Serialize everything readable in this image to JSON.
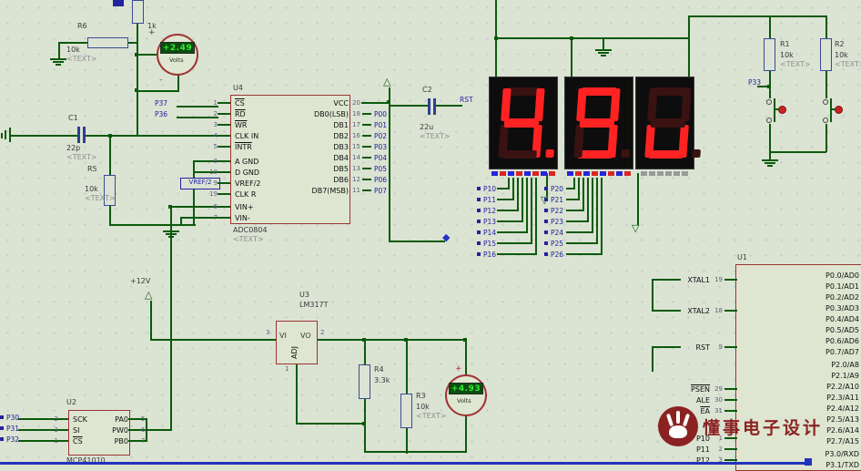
{
  "colors": {
    "wire": "#0b5a0b",
    "net_label": "#23239c",
    "component_outline": "#9a3434",
    "resistor_outline": "#3b4a97",
    "seg_on": "#ff2222",
    "seg_off": "#3a1212",
    "meter_panel_bg": "#0d4d10",
    "meter_panel_text": "#33ee33",
    "watermark": "#8b2222"
  },
  "watermark": {
    "text": "懂事电子设计"
  },
  "power": {
    "rail_label": "+12V"
  },
  "symbols": {
    "plus": "+",
    "minus": "-"
  },
  "icons": {
    "up_arrow": "△",
    "down_arrow": "▽",
    "diamond": "◆"
  },
  "display": {
    "value_shown": "4.9u",
    "digits": [
      {
        "char": "4",
        "dp": true
      },
      {
        "char": "9",
        "dp": false
      },
      {
        "char": "u",
        "dp": false
      }
    ],
    "indicators": {
      "d1": [
        "#2626d8",
        "#d82626",
        "#2626d8",
        "#d82626",
        "#2626d8",
        "#d82626",
        "#2626d8",
        "#d82626"
      ],
      "d2": [
        "#2626d8",
        "#d82626",
        "#2626d8",
        "#d82626",
        "#2626d8",
        "#d82626",
        "#2626d8",
        "#d82626"
      ],
      "d3": [
        "#9a9a9a",
        "#9a9a9a",
        "#9a9a9a",
        "#9a9a9a",
        "#9a9a9a",
        "#9a9a9a"
      ]
    }
  },
  "meters": {
    "vm1": {
      "value": "+2.49",
      "unit": "Volts"
    },
    "vm2": {
      "value": "+4.93",
      "unit": "Volts"
    }
  },
  "parts": {
    "r_top": {
      "value": "1k"
    },
    "r6": {
      "ref": "R6",
      "value": "10k",
      "text": "<TEXT>"
    },
    "r5": {
      "ref": "R5",
      "value": "10k",
      "text": "<TEXT>"
    },
    "r4": {
      "ref": "R4",
      "value": "3.3k"
    },
    "r3": {
      "ref": "R3",
      "value": "10k",
      "text": "<TEXT>"
    },
    "r1": {
      "ref": "R1",
      "value": "10k",
      "text": "<TEXT>"
    },
    "r2": {
      "ref": "R2",
      "value": "10k",
      "text": "<TEXT>"
    },
    "c1": {
      "ref": "C1",
      "value": "22p",
      "text": "<TEXT>"
    },
    "c2": {
      "ref": "C2",
      "value": "22u",
      "text": "<TEXT>"
    },
    "u1": {
      "ref": "U1"
    },
    "u2": {
      "ref": "U2",
      "device": "MCP41010"
    },
    "u3": {
      "ref": "U3",
      "device": "LM317T"
    },
    "u4": {
      "ref": "U4",
      "device": "ADC0804",
      "text": "<TEXT>"
    }
  },
  "nets": {
    "p37": "P37",
    "p36": "P36",
    "vref": "VREF/2",
    "rst": "RST",
    "p33": "P33"
  },
  "u3_pins": {
    "vi": "VI",
    "vo": "VO",
    "adj": "ADJ",
    "vi_num": "3",
    "vo_num": "2",
    "adj_num": "1"
  },
  "u4_left_pins": [
    {
      "num": "1",
      "name": "CS",
      "bar": true
    },
    {
      "num": "2",
      "name": "RD",
      "bar": true
    },
    {
      "num": "3",
      "name": "WR",
      "bar": true
    },
    {
      "num": "4",
      "name": "CLK IN"
    },
    {
      "num": "5",
      "name": "INTR",
      "bar": true
    },
    {
      "num": "8",
      "name": "A GND"
    },
    {
      "num": "10",
      "name": "D GND"
    },
    {
      "num": "9",
      "name": "VREF/2"
    },
    {
      "num": "19",
      "name": "CLK R"
    },
    {
      "num": "6",
      "name": "VIN+"
    },
    {
      "num": "7",
      "name": "VIN-"
    }
  ],
  "u4_right_pins": [
    {
      "num": "20",
      "name": "VCC",
      "net": ""
    },
    {
      "num": "18",
      "name": "DB0(LSB)",
      "net": "P00"
    },
    {
      "num": "17",
      "name": "DB1",
      "net": "P01"
    },
    {
      "num": "16",
      "name": "DB2",
      "net": "P02"
    },
    {
      "num": "15",
      "name": "DB3",
      "net": "P03"
    },
    {
      "num": "14",
      "name": "DB4",
      "net": "P04"
    },
    {
      "num": "13",
      "name": "DB5",
      "net": "P05"
    },
    {
      "num": "12",
      "name": "DB6",
      "net": "P06"
    },
    {
      "num": "11",
      "name": "DB7(MSB)",
      "net": "P07"
    }
  ],
  "u1_left_pins": [
    {
      "num": "19",
      "name": "XTAL1"
    },
    {
      "num": "18",
      "name": "XTAL2"
    },
    {
      "num": "9",
      "name": "RST"
    },
    {
      "num": "29",
      "name": "PSEN",
      "bar": true
    },
    {
      "num": "30",
      "name": "ALE"
    },
    {
      "num": "31",
      "name": "EA",
      "bar": true
    },
    {
      "num": "1",
      "name": "P10"
    },
    {
      "num": "2",
      "name": "P11"
    },
    {
      "num": "3",
      "name": "P12"
    }
  ],
  "u1_right_pins": [
    "P0.0/AD0",
    "P0.1/AD1",
    "P0.2/AD2",
    "P0.3/AD3",
    "P0.4/AD4",
    "P0.5/AD5",
    "P0.6/AD6",
    "P0.7/AD7",
    "P2.0/A8",
    "P2.1/A9",
    "P2.2/A10",
    "P2.3/A11",
    "P2.4/A12",
    "P2.5/A13",
    "P2.6/A14",
    "P2.7/A15",
    "P3.0/RXD",
    "P3.1/TXD"
  ],
  "u2_left_pins": [
    {
      "num": "2",
      "name": "SCK"
    },
    {
      "num": "3",
      "name": "SI"
    },
    {
      "num": "1",
      "name": "CS",
      "bar": true
    }
  ],
  "u2_right_pins": [
    {
      "num": "5",
      "name": "PA0"
    },
    {
      "num": "6",
      "name": "PW0"
    },
    {
      "num": "7",
      "name": "PB0"
    }
  ],
  "p1_terminals": [
    "P10",
    "P11",
    "P12",
    "P13",
    "P14",
    "P15",
    "P16"
  ],
  "p2_terminals": [
    "P20",
    "P21",
    "P22",
    "P23",
    "P24",
    "P25",
    "P26"
  ],
  "u2_net_terminals": [
    "P30",
    "P31",
    "P32"
  ]
}
